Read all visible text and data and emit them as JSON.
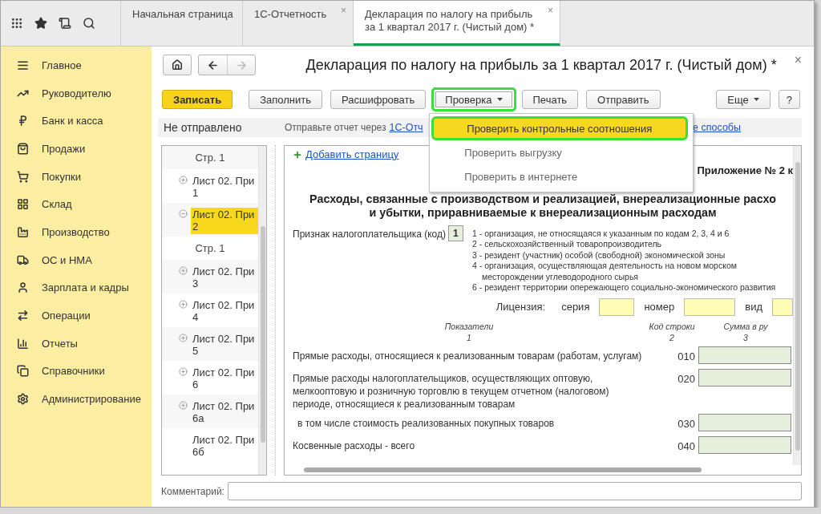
{
  "top_bar": {
    "tabs": [
      {
        "label": "Начальная страница",
        "selected": false
      },
      {
        "label": "1С-Отчетность",
        "selected": false,
        "close": "×"
      },
      {
        "label": "Декларация по налогу на прибыль за 1 квартал 2017 г. (Чистый дом) *",
        "selected": true,
        "close": "×"
      }
    ]
  },
  "sidebar": {
    "items": [
      {
        "label": "Главное"
      },
      {
        "label": "Руководителю"
      },
      {
        "label": "Банк и касса"
      },
      {
        "label": "Продажи"
      },
      {
        "label": "Покупки"
      },
      {
        "label": "Склад"
      },
      {
        "label": "Производство"
      },
      {
        "label": "ОС и НМА"
      },
      {
        "label": "Зарплата и кадры"
      },
      {
        "label": "Операции"
      },
      {
        "label": "Отчеты"
      },
      {
        "label": "Справочники"
      },
      {
        "label": "Администрирование"
      }
    ]
  },
  "form_header": {
    "title": "Декларация по налогу на прибыль за 1 квартал 2017 г. (Чистый дом) *",
    "close": "×"
  },
  "toolbar": {
    "buttons": [
      {
        "label": "Записать",
        "kind": "primary",
        "highlighted": false
      },
      {
        "label": "Заполнить",
        "kind": "plain",
        "highlighted": false
      },
      {
        "label": "Расшифровать",
        "kind": "plain",
        "highlighted": false
      },
      {
        "label": "Проверка",
        "kind": "menu",
        "highlighted": true
      },
      {
        "label": "Печать",
        "kind": "plain",
        "highlighted": false
      },
      {
        "label": "Отправить",
        "kind": "plain",
        "highlighted": false
      }
    ],
    "more": "Еще",
    "help": "?"
  },
  "dropdown": {
    "open": true,
    "items": [
      {
        "label": "Проверить контрольные соотношения",
        "selected": true
      },
      {
        "label": "Проверить выгрузку",
        "selected": false
      },
      {
        "label": "Проверить в интернете",
        "selected": false
      }
    ]
  },
  "status": {
    "state": "Не отправлено",
    "hint": "Отправьте отчет через",
    "link_1": "1С-Отч",
    "link_2": "е способы"
  },
  "tree": {
    "items": [
      {
        "kind": "page",
        "label": "Стр. 1"
      },
      {
        "kind": "sheet",
        "label": "Лист 02. При",
        "number": "1",
        "expanded": false,
        "selected": false
      },
      {
        "kind": "sheet",
        "label": "Лист 02. При",
        "number": "2",
        "expanded": true,
        "selected": true,
        "children": [
          {
            "kind": "page",
            "label": "Стр. 1"
          }
        ]
      },
      {
        "kind": "sheet",
        "label": "Лист 02. При",
        "number": "3",
        "expanded": false,
        "selected": false
      },
      {
        "kind": "sheet",
        "label": "Лист 02. При",
        "number": "4",
        "expanded": false,
        "selected": false
      },
      {
        "kind": "sheet",
        "label": "Лист 02. При",
        "number": "5",
        "expanded": false,
        "selected": false
      },
      {
        "kind": "sheet",
        "label": "Лист 02. При",
        "number": "6",
        "expanded": false,
        "selected": false
      },
      {
        "kind": "sheet",
        "label": "Лист 02. При",
        "number": "6а",
        "expanded": false,
        "selected": false
      },
      {
        "kind": "sheet",
        "label": "Лист 02. При",
        "number": "6б",
        "selected": false
      }
    ]
  },
  "form": {
    "add_page": "Добавить страницу",
    "appendix": "Приложение № 2 к",
    "heading": [
      "Расходы, связанные с производством и реализацией, внереализационные расхо",
      "и убытки, приравниваемые к внереализационным расходам"
    ],
    "taxpayer": {
      "label": "Признак налогоплательщика (код)",
      "value": "1",
      "codes": [
        "1 - организация, не относящаяся к указанным по кодам 2, 3, 4 и 6",
        "2 - сельскохозяйственный товаропроизводитель",
        "3 - резидент (участник) особой (свободной) экономической зоны",
        "4 - организация, осуществляющая деятельность на новом морском месторождении углеводородного сырья",
        "6 - резидент территории опережающего социально-экономического развития"
      ]
    },
    "license": {
      "label": "Лицензия:",
      "fields": [
        "серия",
        "номер",
        "вид"
      ]
    },
    "columns": [
      {
        "title": "Показатели",
        "index": "1"
      },
      {
        "title": "Код строки",
        "index": "2"
      },
      {
        "title": "Сумма в ру",
        "index": "3"
      }
    ],
    "rows": [
      {
        "label": "Прямые расходы, относящиеся к реализованным товарам (работам, услугам)",
        "code": "010"
      },
      {
        "label": "Прямые расходы налогоплательщиков, осуществляющих оптовую, мелкооптовую и розничную торговлю в текущем отчетном (налоговом) периоде, относящиеся к реализованным товарам",
        "code": "020",
        "children": [
          {
            "label": "в том числе стоимость реализованных покупных товаров",
            "code": "030"
          }
        ]
      },
      {
        "label": "Косвенные расходы - всего",
        "code": "040"
      }
    ]
  },
  "comment": {
    "label": "Комментарий:"
  }
}
